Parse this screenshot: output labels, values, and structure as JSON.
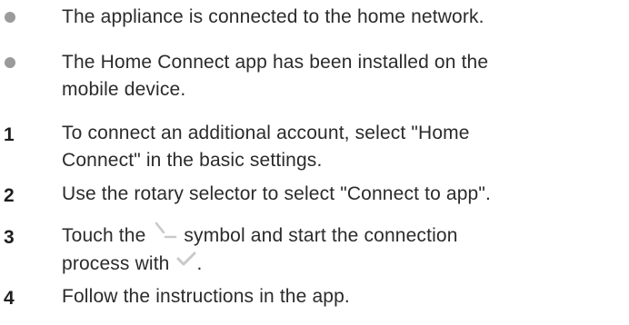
{
  "prerequisites": [
    {
      "lines": [
        "The appliance is connected to the home network."
      ],
      "icon": "bullet-dot"
    },
    {
      "lines": [
        "The Home Connect app has been installed on the",
        "mobile device."
      ],
      "icon": "bullet-dot"
    }
  ],
  "steps": [
    {
      "number": "1",
      "lines": [
        "To connect an additional account, select \"Home",
        "Connect\" in the basic settings."
      ]
    },
    {
      "number": "2",
      "lines": [
        "Use the rotary selector to select \"Connect to app\"."
      ]
    },
    {
      "number": "3",
      "line1_before": "Touch the ",
      "line1_symbol": "connect-symbol-icon",
      "line1_after": " symbol and start the connection",
      "line2_before": "process with ",
      "line2_symbol": "checkmark-icon",
      "line2_after": "."
    },
    {
      "number": "4",
      "lines": [
        "Follow the instructions in the app."
      ]
    }
  ],
  "colors": {
    "text": "#2b2b2b",
    "bullet": "#9b9b9b",
    "symbol": "#c9c9c9"
  }
}
